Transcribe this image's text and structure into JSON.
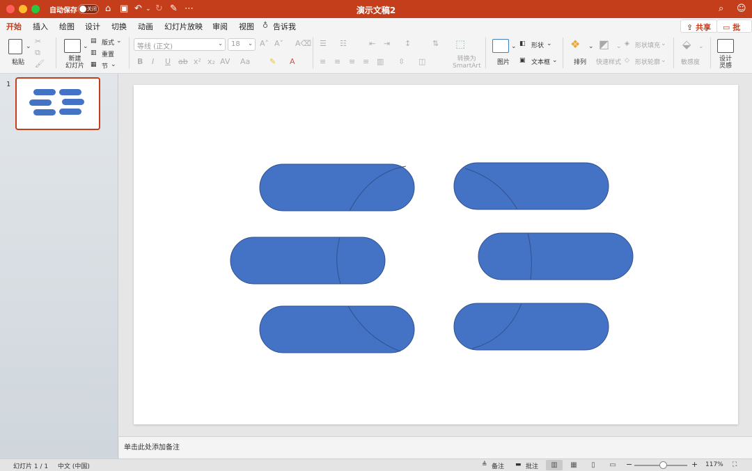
{
  "titlebar": {
    "autosave_label": "自动保存",
    "toggle_state": "关闭",
    "title": "演示文稿2"
  },
  "tabs": [
    {
      "label": "开始",
      "active": true
    },
    {
      "label": "插入"
    },
    {
      "label": "绘图"
    },
    {
      "label": "设计"
    },
    {
      "label": "切换"
    },
    {
      "label": "动画"
    },
    {
      "label": "幻灯片放映"
    },
    {
      "label": "审阅"
    },
    {
      "label": "视图"
    },
    {
      "label": "告诉我"
    }
  ],
  "share": {
    "share_label": "共享",
    "comment_label": "批注"
  },
  "ribbon": {
    "paste": "粘贴",
    "new_slide": "新建\n幻灯片",
    "layout": "版式",
    "reset": "重置",
    "section": "节",
    "font_name": "等线 (正文)",
    "font_size": "18",
    "convert_smartart": "转换为\nSmartArt",
    "picture": "图片",
    "shape": "形状",
    "textbox": "文本框",
    "arrange": "排列",
    "quick_styles": "快速样式",
    "shape_fill": "形状填充",
    "shape_outline": "形状轮廓",
    "sensitivity": "敏感度",
    "designer": "设计\n灵感"
  },
  "thumbnail": {
    "number": "1"
  },
  "slide": {
    "shape_fill": "#4472c4",
    "shape_stroke": "#2f528f"
  },
  "notes": {
    "placeholder": "单击此处添加备注"
  },
  "status": {
    "slide_count": "幻灯片 1 / 1",
    "language": "中文 (中国)",
    "notes_btn": "备注",
    "comments_btn": "批注",
    "zoom": "117%"
  },
  "colors": {
    "accent": "#c43e1c"
  }
}
